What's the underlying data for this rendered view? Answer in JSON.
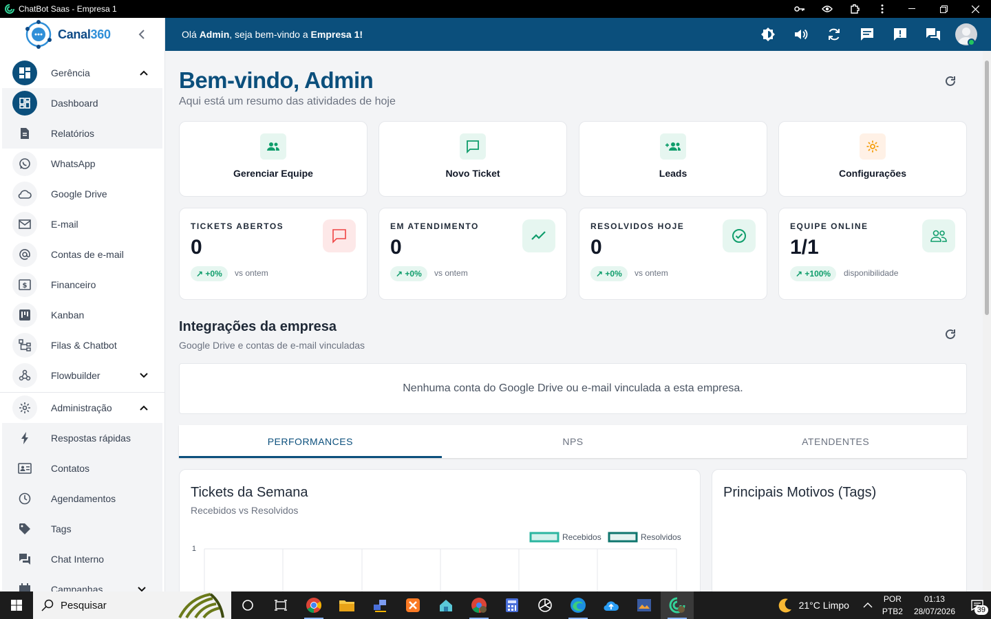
{
  "window": {
    "title": "ChatBot Saas - Empresa 1"
  },
  "logo": {
    "prefix": "Canal",
    "suffix": "360"
  },
  "header": {
    "greet_prefix": "Olá ",
    "user": "Admin",
    "greet_mid": ", seja bem-vindo a ",
    "company": "Empresa 1!"
  },
  "sidebar": {
    "items": [
      {
        "label": "Gerência"
      },
      {
        "label": "Dashboard"
      },
      {
        "label": "Relatórios"
      },
      {
        "label": "WhatsApp"
      },
      {
        "label": "Google Drive"
      },
      {
        "label": "E-mail"
      },
      {
        "label": "Contas de e-mail"
      },
      {
        "label": "Financeiro"
      },
      {
        "label": "Kanban"
      },
      {
        "label": "Filas & Chatbot"
      },
      {
        "label": "Flowbuilder"
      },
      {
        "label": "Administração"
      },
      {
        "label": "Respostas rápidas"
      },
      {
        "label": "Contatos"
      },
      {
        "label": "Agendamentos"
      },
      {
        "label": "Tags"
      },
      {
        "label": "Chat Interno"
      },
      {
        "label": "Campanhas"
      }
    ]
  },
  "page": {
    "title": "Bem-vindo, Admin",
    "subtitle": "Aqui está um resumo das atividades de hoje"
  },
  "quick_actions": [
    {
      "label": "Gerenciar Equipe"
    },
    {
      "label": "Novo Ticket"
    },
    {
      "label": "Leads"
    },
    {
      "label": "Configurações"
    }
  ],
  "stats": [
    {
      "label": "TICKETS ABERTOS",
      "value": "0",
      "delta": "↗ +0%",
      "compare": "vs ontem"
    },
    {
      "label": "EM ATENDIMENTO",
      "value": "0",
      "delta": "↗ +0%",
      "compare": "vs ontem"
    },
    {
      "label": "RESOLVIDOS HOJE",
      "value": "0",
      "delta": "↗ +0%",
      "compare": "vs ontem"
    },
    {
      "label": "EQUIPE ONLINE",
      "value": "1/1",
      "delta": "↗ +100%",
      "compare": "disponibilidade"
    }
  ],
  "integrations": {
    "title": "Integrações da empresa",
    "subtitle": "Google Drive e contas de e-mail vinculadas",
    "empty": "Nenhuma conta do Google Drive ou e-mail vinculada a esta empresa."
  },
  "tabs": [
    {
      "label": "PERFORMANCES"
    },
    {
      "label": "NPS"
    },
    {
      "label": "ATENDENTES"
    }
  ],
  "weekly_chart": {
    "title": "Tickets da Semana",
    "subtitle": "Recebidos vs Resolvidos",
    "legend": [
      "Recebidos",
      "Resolvidos"
    ],
    "y_tick": "1"
  },
  "tags_card": {
    "title": "Principais Motivos (Tags)"
  },
  "chart_data": {
    "type": "line",
    "series": [
      {
        "name": "Recebidos",
        "color": "#2bb5a0"
      },
      {
        "name": "Resolvidos",
        "color": "#0f766e"
      }
    ],
    "y_ticks": [
      "1"
    ],
    "grid": true,
    "legend": "top-right"
  },
  "taskbar": {
    "search_placeholder": "Pesquisar",
    "weather": "21°C  Limpo",
    "lang_1": "POR",
    "lang_2": "PTB2",
    "time": "01:13",
    "date": "28/07/2026",
    "notifications": "39"
  },
  "colors": {
    "primary": "#0b4f7c",
    "accent_green": "#0f9d6b",
    "online": "#22c55e"
  }
}
